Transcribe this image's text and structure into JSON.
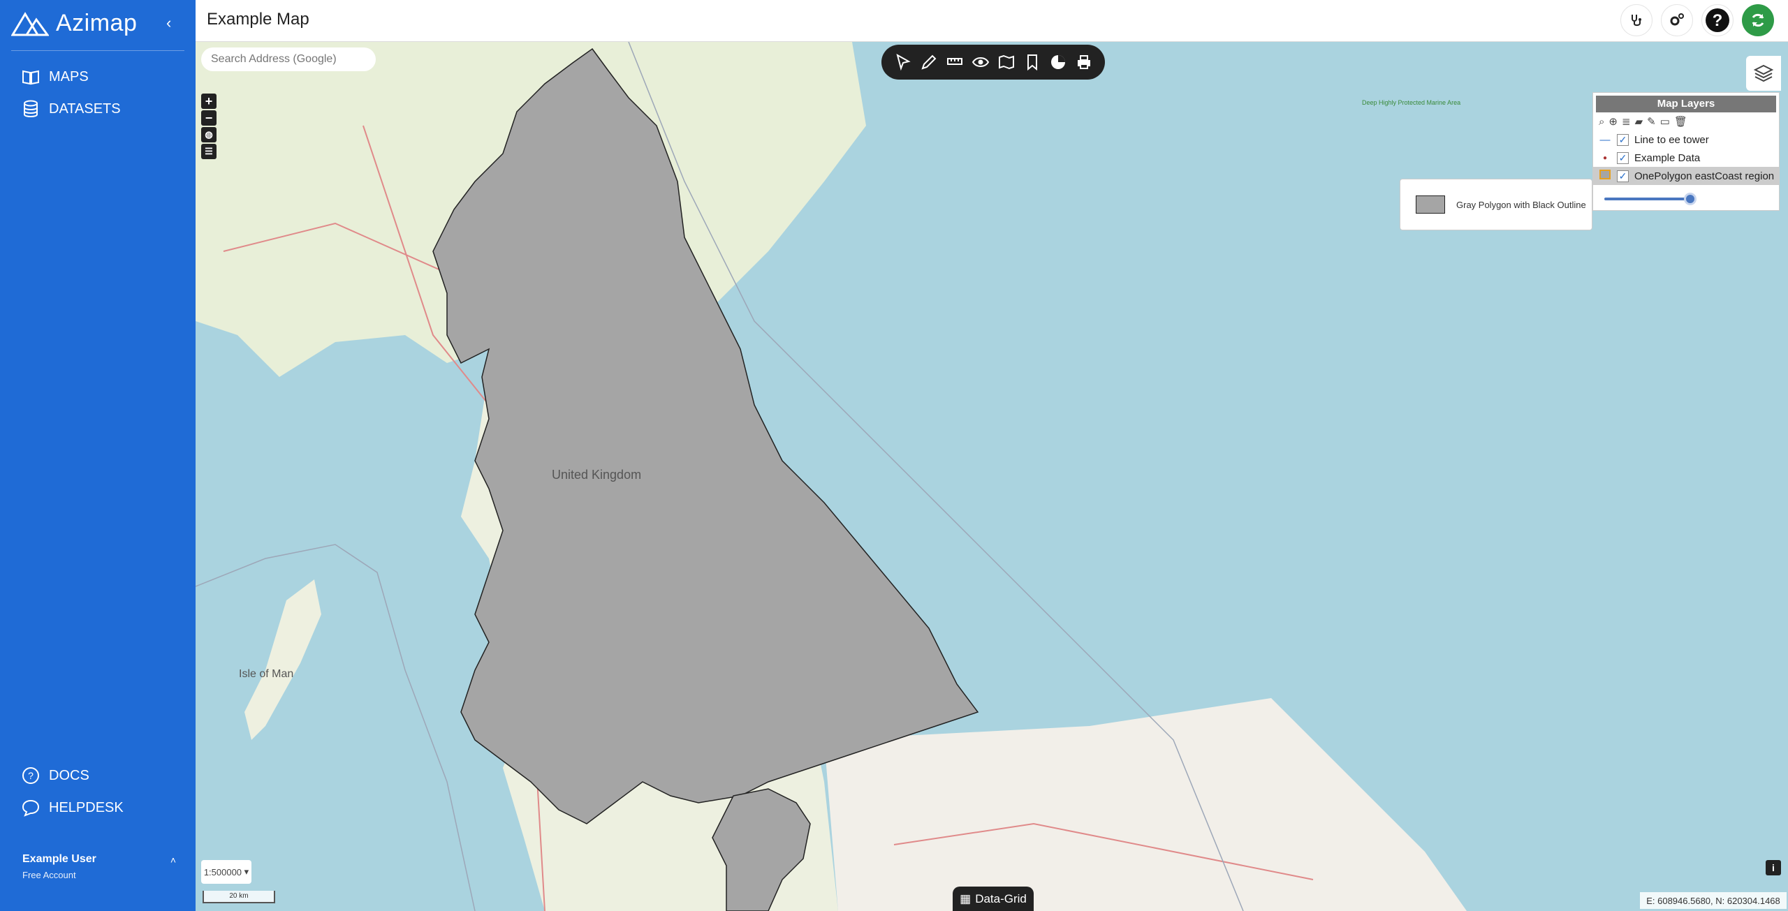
{
  "app": {
    "name": "Azimap"
  },
  "sidebar": {
    "items": [
      {
        "label": "MAPS",
        "icon": "book-icon"
      },
      {
        "label": "DATASETS",
        "icon": "database-icon"
      }
    ],
    "bottom_items": [
      {
        "label": "DOCS",
        "icon": "question-circle-icon"
      },
      {
        "label": "HELPDESK",
        "icon": "chat-icon"
      }
    ],
    "user": {
      "name": "Example User",
      "plan": "Free Account"
    }
  },
  "header": {
    "title": "Example Map"
  },
  "search": {
    "placeholder": "Search Address (Google)"
  },
  "map_labels": [
    {
      "text": "United Kingdom"
    },
    {
      "text": "Isle of Man"
    },
    {
      "text": "Deep Highly Protected Marine Area"
    }
  ],
  "layers_panel": {
    "title": "Map Layers",
    "layers": [
      {
        "name": "Line to ee tower",
        "checked": true,
        "symbol": "line"
      },
      {
        "name": "Example Data",
        "checked": true,
        "symbol": "point"
      },
      {
        "name": "OnePolygon eastCoast region",
        "checked": true,
        "symbol": "polygon",
        "selected": true
      }
    ],
    "opacity": 0.9
  },
  "legend": {
    "label": "Gray Polygon with Black Outline"
  },
  "scale": {
    "value": "1:500000",
    "bar_label": "20 km"
  },
  "data_grid": {
    "label": "Data-Grid"
  },
  "coordinates": {
    "text": "E: 608946.5680, N: 620304.1468"
  },
  "colors": {
    "sidebar": "#1f6bd6",
    "water": "#aad3df",
    "land": "#f2efe9",
    "polygon": "#a5a5a5",
    "refresh": "#2e9b47"
  }
}
